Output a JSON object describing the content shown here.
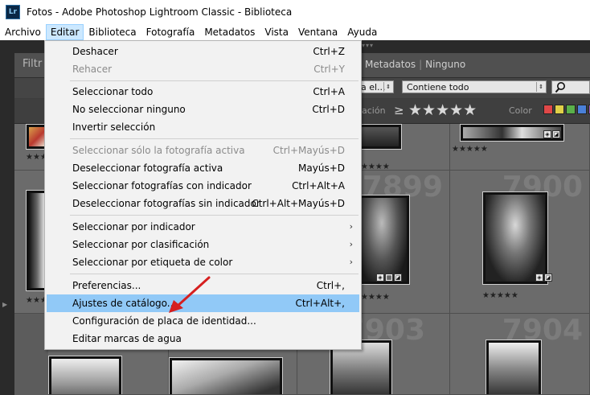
{
  "window": {
    "app_icon": "Lr",
    "title": "Fotos - Adobe Photoshop Lightroom Classic - Biblioteca"
  },
  "menubar": [
    {
      "label": "Archivo"
    },
    {
      "label": "Editar"
    },
    {
      "label": "Biblioteca"
    },
    {
      "label": "Fotografía"
    },
    {
      "label": "Metadatos"
    },
    {
      "label": "Vista"
    },
    {
      "label": "Ventana"
    },
    {
      "label": "Ayuda"
    }
  ],
  "active_menu": "Editar",
  "edit_menu": {
    "items": [
      {
        "label": "Deshacer",
        "shortcut": "Ctrl+Z",
        "disabled": false
      },
      {
        "label": "Rehacer",
        "shortcut": "Ctrl+Y",
        "disabled": true
      },
      {
        "label": "Seleccionar todo",
        "shortcut": "Ctrl+A",
        "disabled": false
      },
      {
        "label": "No seleccionar ninguno",
        "shortcut": "Ctrl+D",
        "disabled": false
      },
      {
        "label": "Invertir selección",
        "shortcut": "",
        "disabled": false
      },
      {
        "label": "Seleccionar sólo la fotografía activa",
        "shortcut": "Ctrl+Mayús+D",
        "disabled": true
      },
      {
        "label": "Deseleccionar fotografía activa",
        "shortcut": "Mayús+D",
        "disabled": false
      },
      {
        "label": "Seleccionar fotografías con indicador",
        "shortcut": "Ctrl+Alt+A",
        "disabled": false
      },
      {
        "label": "Deseleccionar fotografías sin indicador",
        "shortcut": "Ctrl+Alt+Mayús+D",
        "disabled": false
      },
      {
        "label": "Seleccionar por indicador",
        "shortcut": "",
        "submenu": true,
        "disabled": false
      },
      {
        "label": "Seleccionar por clasificación",
        "shortcut": "",
        "submenu": true,
        "disabled": false
      },
      {
        "label": "Seleccionar por etiqueta de color",
        "shortcut": "",
        "submenu": true,
        "disabled": false
      },
      {
        "label": "Preferencias...",
        "shortcut": "Ctrl+,",
        "disabled": false
      },
      {
        "label": "Ajustes de catálogo...",
        "shortcut": "Ctrl+Alt+,",
        "disabled": false,
        "highlighted": true
      },
      {
        "label": "Configuración de placa de identidad...",
        "shortcut": "",
        "disabled": false
      },
      {
        "label": "Editar marcas de agua",
        "shortcut": "",
        "disabled": false
      }
    ],
    "submenu_arrow": "›"
  },
  "library_filter": {
    "label": "Filtr",
    "tabs": [
      "Metadatos",
      "Ninguno"
    ],
    "tab_separator": "|",
    "text_field_select": "a el...",
    "rule_select": "Contiene todo",
    "attribute_label": "ación",
    "rating_operator": "≥",
    "rating_stars": "★★★★★",
    "color_label": "Color",
    "color_swatches": [
      "#e04848",
      "#e0d048",
      "#5ab04a",
      "#4a80d8",
      "#9a5ac0"
    ]
  },
  "grid": {
    "cell_numbers": [
      "7899",
      "7900",
      "7903",
      "7904"
    ],
    "cell_stars": "★★★★★"
  },
  "colors": {
    "menu_highlight": "#91c9f7",
    "active_menu_bg": "#cce8ff",
    "annotation_arrow": "#d61f1f"
  }
}
